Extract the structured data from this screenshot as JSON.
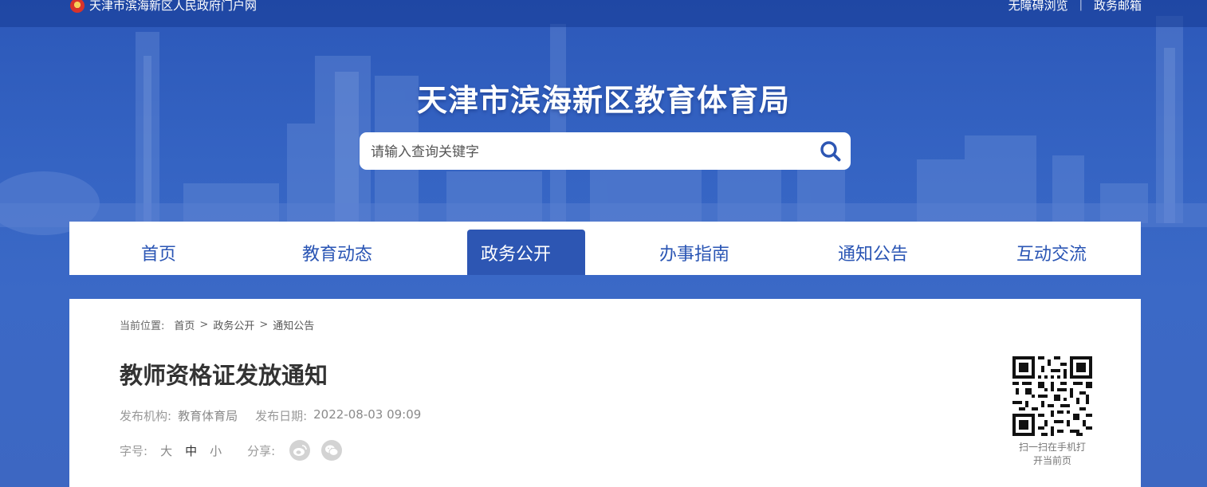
{
  "topbar": {
    "portal_name": "天津市滨海新区人民政府门户网",
    "links": [
      "无障碍浏览",
      "政务邮箱"
    ]
  },
  "site_title": "天津市滨海新区教育体育局",
  "search": {
    "placeholder": "请输入查询关键字",
    "icon": "search-icon"
  },
  "nav": {
    "items": [
      "首页",
      "教育动态",
      "政务公开",
      "办事指南",
      "通知公告",
      "互动交流"
    ],
    "active": "政务公开"
  },
  "breadcrumb": {
    "label": "当前位置:",
    "items": [
      "首页",
      "政务公开",
      "通知公告"
    ],
    "separator": ">"
  },
  "article": {
    "title": "教师资格证发放通知",
    "publisher_label": "发布机构:",
    "publisher": "教育体育局",
    "date_label": "发布日期:",
    "date": "2022-08-03 09:09",
    "font_label": "字号:",
    "font_sizes": [
      "大",
      "中",
      "小"
    ],
    "current_font_size": "中",
    "share_label": "分享:",
    "share_icons": [
      "weibo-icon",
      "wechat-icon"
    ]
  },
  "qr": {
    "caption_line1": "扫一扫在手机打",
    "caption_line2": "开当前页"
  },
  "colors": {
    "brand_blue": "#2d56b3",
    "nav_text": "#2a55b4"
  }
}
